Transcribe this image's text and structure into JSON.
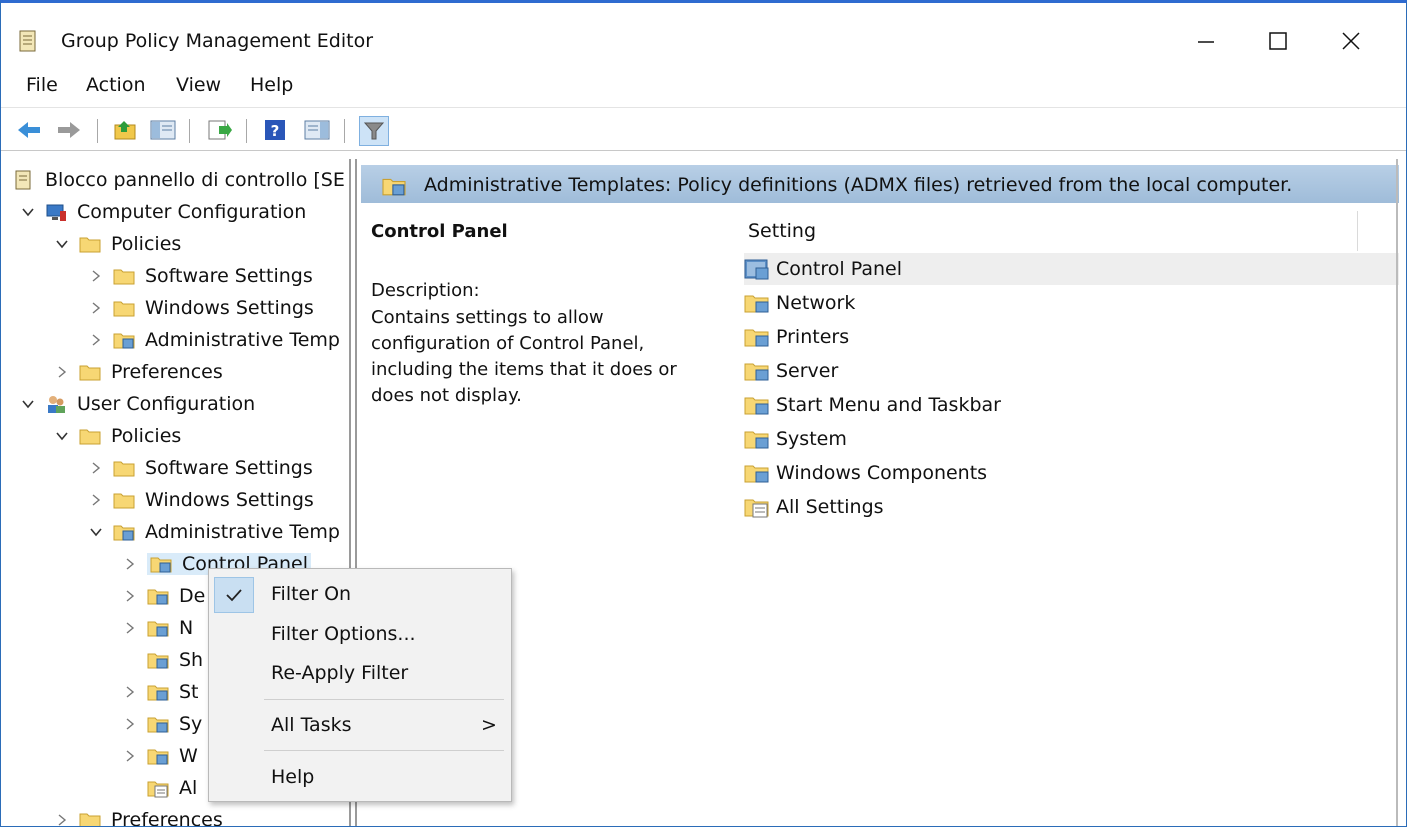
{
  "window": {
    "title": "Group Policy Management Editor",
    "accent": "#2f6bd0"
  },
  "menu": {
    "items": [
      "File",
      "Action",
      "View",
      "Help"
    ]
  },
  "toolbar": {
    "icons": [
      "back-icon",
      "forward-icon",
      "up-folder-icon",
      "show-hide-tree-icon",
      "export-list-icon",
      "help-icon",
      "show-hide-action-pane-icon",
      "filter-icon"
    ]
  },
  "tree": {
    "root": "Blocco pannello di controllo [SE",
    "computer_config": "Computer Configuration",
    "cc_policies": "Policies",
    "cc_software": "Software Settings",
    "cc_windows": "Windows Settings",
    "cc_admin": "Administrative Temp",
    "cc_prefs": "Preferences",
    "user_config": "User Configuration",
    "uc_policies": "Policies",
    "uc_software": "Software Settings",
    "uc_windows": "Windows Settings",
    "uc_admin": "Administrative Temp",
    "control_panel": "Control Panel",
    "d_partial": "De",
    "n_partial": "N",
    "sh_partial": "Sh",
    "st_partial": "St",
    "sy_partial": "Sy",
    "w_partial": "W",
    "al_partial": "Al",
    "uc_prefs": "Preferences"
  },
  "banner": {
    "text": "Administrative Templates: Policy definitions (ADMX files) retrieved from the local computer."
  },
  "detail": {
    "title": "Control Panel",
    "desc_label": "Description:",
    "desc_text": "Contains settings to allow configuration of Control Panel, including the items that it does or does not display."
  },
  "list": {
    "column": "Setting",
    "rows": [
      "Control Panel",
      "Network",
      "Printers",
      "Server",
      "Start Menu and Taskbar",
      "System",
      "Windows Components",
      "All Settings"
    ]
  },
  "context_menu": {
    "filter_on": "Filter On",
    "filter_options": "Filter Options...",
    "reapply": "Re-Apply Filter",
    "all_tasks": "All Tasks",
    "arrow": ">",
    "help": "Help"
  }
}
